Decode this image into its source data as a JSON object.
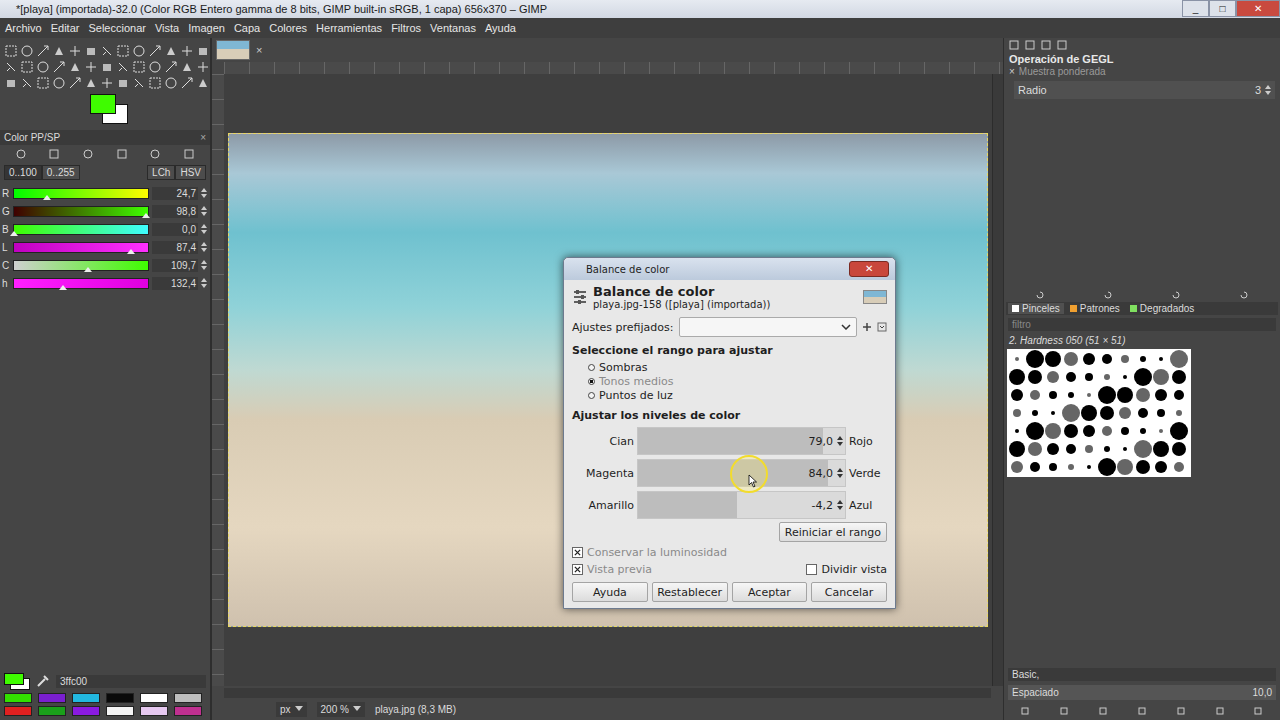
{
  "window": {
    "title": "*[playa] (importada)-32.0 (Color RGB Entero gamma de 8 bits, GIMP built-in sRGB, 1 capa) 656x370 – GIMP",
    "controls": [
      "_",
      "□",
      "✕"
    ]
  },
  "menu": [
    "Archivo",
    "Editar",
    "Seleccionar",
    "Vista",
    "Imagen",
    "Capa",
    "Colores",
    "Herramientas",
    "Filtros",
    "Ventanas",
    "Ayuda"
  ],
  "toolbox": {
    "fg_color": "#3ffc00",
    "bg_color": "#ffffff"
  },
  "color_dock": {
    "title": "Color PP/SP",
    "close": "×",
    "ranges": [
      {
        "label": "0..100",
        "selected": true
      },
      {
        "label": "0..255",
        "selected": false
      }
    ],
    "models": [
      {
        "label": "LCh",
        "selected": false
      },
      {
        "label": "HSV",
        "selected": false
      }
    ],
    "sliders": [
      {
        "label": "R",
        "value": "24,7",
        "level": 0.247,
        "colors": [
          "#00fc00",
          "#fffc00"
        ]
      },
      {
        "label": "G",
        "value": "98,8",
        "level": 0.988,
        "colors": [
          "#3f0000",
          "#3fff00"
        ]
      },
      {
        "label": "B",
        "value": "0,0",
        "level": 0.0,
        "colors": [
          "#3ffc00",
          "#3ffcff"
        ]
      },
      {
        "label": "L",
        "value": "87,4",
        "level": 0.874,
        "colors": [
          "#c000c0",
          "#ff30ff"
        ]
      },
      {
        "label": "C",
        "value": "109,7",
        "level": 0.55,
        "colors": [
          "#d0d0d0",
          "#3ffc00"
        ]
      },
      {
        "label": "h",
        "value": "132,4",
        "level": 0.368,
        "colors": [
          "#ff20ff",
          "#e000e0"
        ]
      }
    ],
    "hex": "3ffc00"
  },
  "palette": [
    {
      "color": "#33e000"
    },
    {
      "color": "#7a1fd0"
    },
    {
      "color": "#22b8e0"
    },
    {
      "color": "#0a0a0a"
    },
    {
      "color": "#ffffff"
    },
    {
      "color": "#bdbdbd"
    },
    {
      "color": "#e02020"
    },
    {
      "color": "#1aa01a"
    },
    {
      "color": "#8a1ae0"
    },
    {
      "color": "#f4f4f4"
    },
    {
      "color": "#e6c8f0"
    },
    {
      "color": "#c03090"
    }
  ],
  "canvas": {
    "tab_close": "×",
    "status": {
      "unit": "px",
      "zoom": "200 %",
      "info": "playa.jpg (8,3 MB)"
    }
  },
  "gegl": {
    "title": "Operación de GEGL",
    "close": "×",
    "subtitle": "Muestra ponderada",
    "field": {
      "label": "Radio",
      "value": "3"
    }
  },
  "brushes": {
    "tabs": [
      {
        "label": "Pinceles",
        "selected": true,
        "color": "#ffffff"
      },
      {
        "label": "Patrones",
        "selected": false,
        "color": "#f0a030"
      },
      {
        "label": "Degradados",
        "selected": false,
        "color": "#80e060"
      }
    ],
    "filter_placeholder": "filtro",
    "current": "2. Hardness 050 (51 × 51)",
    "tag": "Basic,",
    "spacing": {
      "label": "Espaciado",
      "value": "10,0"
    }
  },
  "dialog": {
    "title": "Balance de color",
    "close": "✕",
    "heading": "Balance de color",
    "subheading": "playa.jpg-158 ([playa] (importada))",
    "presets_label": "Ajustes prefijados:",
    "presets_value": "",
    "range_title": "Seleccione el rango para ajustar",
    "ranges": [
      {
        "label": "Sombras",
        "selected": false,
        "disabled": false
      },
      {
        "label": "Tonos medios",
        "selected": true,
        "disabled": true
      },
      {
        "label": "Puntos de luz",
        "selected": false,
        "disabled": false
      }
    ],
    "levels_title": "Ajustar los niveles de color",
    "levels": [
      {
        "left": "Cian",
        "right": "Rojo",
        "value": "79,0",
        "level": 0.895
      },
      {
        "left": "Magenta",
        "right": "Verde",
        "value": "84,0",
        "level": 0.92
      },
      {
        "left": "Amarillo",
        "right": "Azul",
        "value": "-4,2",
        "level": 0.479
      }
    ],
    "reset_range": "Reiniciar el rango",
    "checks": [
      {
        "label": "Conservar la luminosidad",
        "checked": true,
        "disabled": true
      },
      {
        "label": "Vista previa",
        "checked": true,
        "disabled": true
      },
      {
        "label": "Dividir vista",
        "checked": false,
        "disabled": false
      }
    ],
    "buttons": [
      "Ayuda",
      "Restablecer",
      "Aceptar",
      "Cancelar"
    ]
  }
}
